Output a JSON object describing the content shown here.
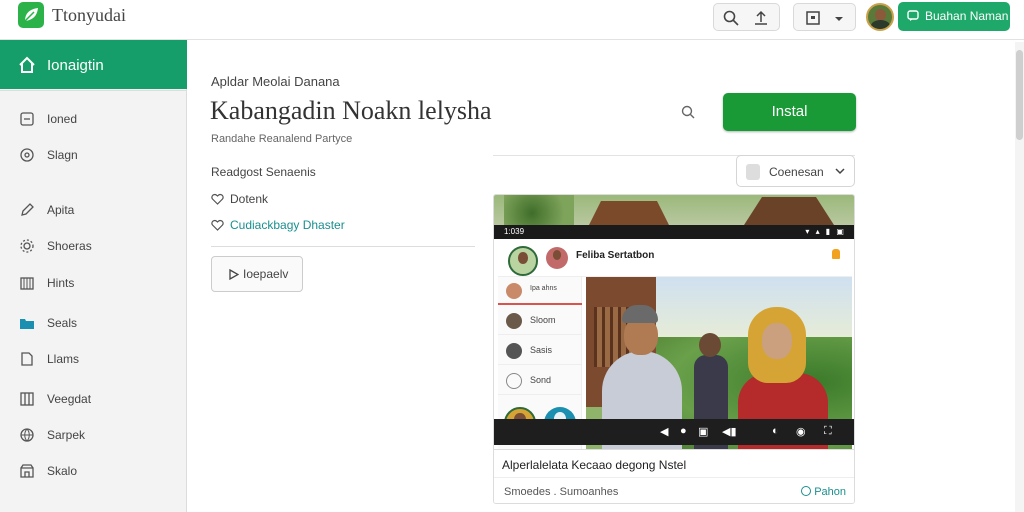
{
  "app": {
    "title": "Ttonyudai"
  },
  "topbar": {
    "primary_button": "Buahan Naman"
  },
  "sidebar": {
    "header": "Ionaigtin",
    "items": [
      {
        "label": "Ioned",
        "icon": "square-icon"
      },
      {
        "label": "Slagn",
        "icon": "search-icon"
      },
      {
        "label": "Apita",
        "icon": "pen-icon"
      },
      {
        "label": "Shoeras",
        "icon": "gear-icon"
      },
      {
        "label": "Hints",
        "icon": "building-icon"
      },
      {
        "label": "Seals",
        "icon": "folder-icon"
      },
      {
        "label": "Llams",
        "icon": "document-icon"
      },
      {
        "label": "Veegdat",
        "icon": "columns-icon"
      },
      {
        "label": "Sarpek",
        "icon": "globe-icon"
      },
      {
        "label": "Skalo",
        "icon": "shop-icon"
      }
    ]
  },
  "main": {
    "subtitle": "Apldar Meolai Danana",
    "title": "Kabangadin Noakn lelysha",
    "meta": "Randahe Reanalend Partyce",
    "section": "Readgost Senaenis",
    "tags": [
      {
        "label": "Dotenk",
        "link": false
      },
      {
        "label": "Cudiackbagy Dhaster",
        "link": true
      }
    ],
    "play_button": "Ioepaelv",
    "install_button": "Instal",
    "dropdown": "Coenesan"
  },
  "preview": {
    "status_time": "1:039",
    "chat_title": "Feliba Sertatbon",
    "contacts": [
      "Ipa  ahns",
      "Sloom",
      "Sasis",
      "Sond"
    ],
    "caption": "Alperlalelata Kecaao degong Nstel",
    "footer_left": "Smoedes . Sumoanhes",
    "footer_right": "Pahon"
  },
  "colors": {
    "primary_green": "#159e6a",
    "install_green": "#1a9a36",
    "link_teal": "#1b8f8f"
  }
}
